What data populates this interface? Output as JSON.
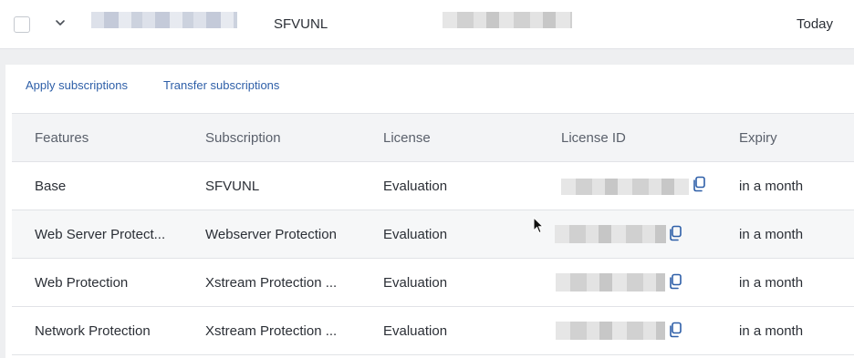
{
  "top_row": {
    "name": "SFVUNL",
    "date": "Today"
  },
  "actions": {
    "apply_label": "Apply subscriptions",
    "transfer_label": "Transfer subscriptions"
  },
  "table": {
    "headers": [
      "Features",
      "Subscription",
      "License",
      "License ID",
      "Expiry"
    ],
    "rows": [
      {
        "feature": "Base",
        "subscription": "SFVUNL",
        "license": "Evaluation",
        "expiry": "in a month"
      },
      {
        "feature": "Web Server Protect...",
        "subscription": "Webserver Protection",
        "license": "Evaluation",
        "expiry": "in a month"
      },
      {
        "feature": "Web Protection",
        "subscription": "Xstream Protection ...",
        "license": "Evaluation",
        "expiry": "in a month"
      },
      {
        "feature": "Network Protection",
        "subscription": "Xstream Protection ...",
        "license": "Evaluation",
        "expiry": "in a month"
      }
    ]
  },
  "icons": {
    "chevron": "chevron-down-icon",
    "copy": "copy-icon",
    "cursor": "mouse-pointer-icon"
  },
  "colors": {
    "link": "#2e5fa8",
    "header_bg": "#f3f4f6",
    "copy_icon": "#2e5fa8"
  }
}
